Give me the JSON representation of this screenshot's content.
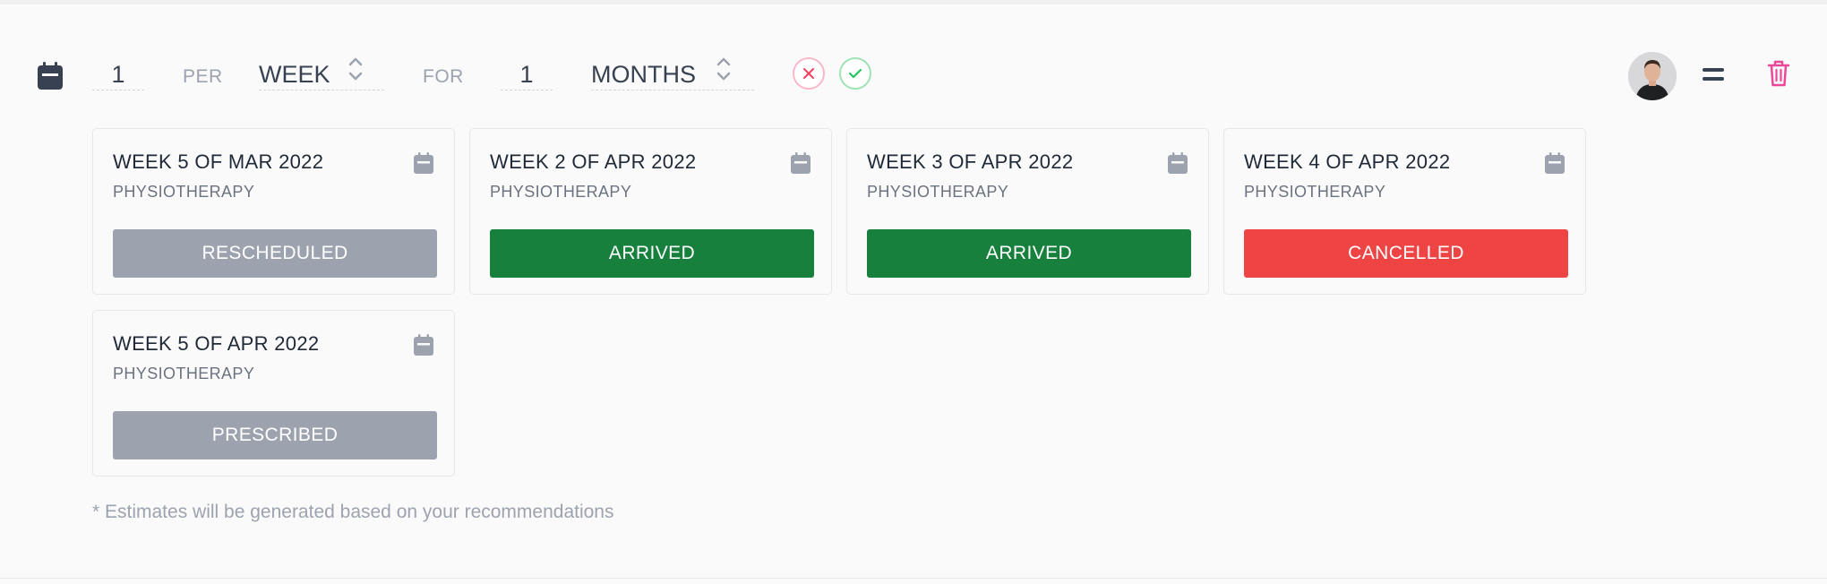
{
  "recurrence": {
    "count": "1",
    "per_label": "PER",
    "period": "WEEK",
    "for_label": "FOR",
    "duration": "1",
    "duration_unit": "MONTHS"
  },
  "colors": {
    "rescheduled": "#9ca3af",
    "arrived": "#17803d",
    "cancelled": "#ef4444",
    "prescribed": "#9ca3af",
    "trash": "#ec4899",
    "cancel_x": "#f43f5e",
    "confirm_check": "#22c55e"
  },
  "sessions": [
    {
      "title": "WEEK 5 OF MAR 2022",
      "type": "PHYSIOTHERAPY",
      "status": "RESCHEDULED"
    },
    {
      "title": "WEEK 2 OF APR 2022",
      "type": "PHYSIOTHERAPY",
      "status": "ARRIVED"
    },
    {
      "title": "WEEK 3 OF APR 2022",
      "type": "PHYSIOTHERAPY",
      "status": "ARRIVED"
    },
    {
      "title": "WEEK 4 OF APR 2022",
      "type": "PHYSIOTHERAPY",
      "status": "CANCELLED"
    },
    {
      "title": "WEEK 5 OF APR 2022",
      "type": "PHYSIOTHERAPY",
      "status": "PRESCRIBED"
    }
  ],
  "footnote": "* Estimates will be generated based on your recommendations"
}
